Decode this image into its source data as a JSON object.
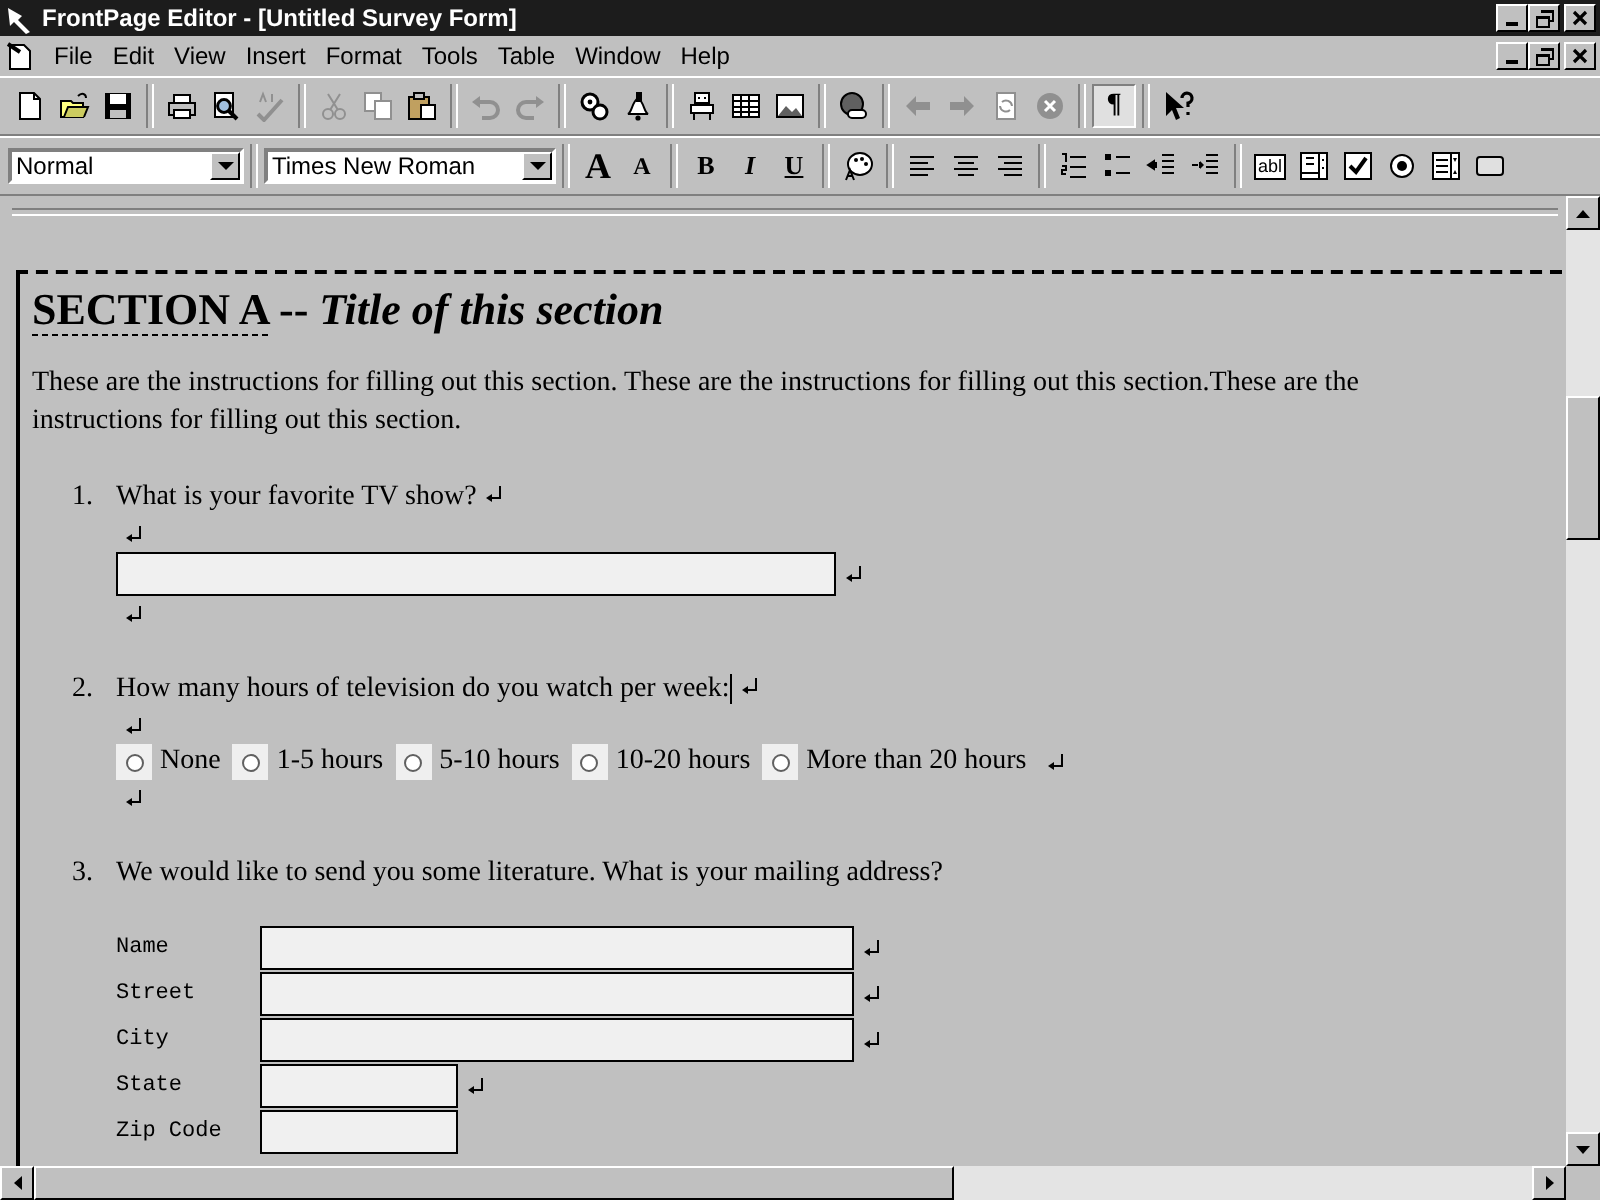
{
  "window": {
    "title": "FrontPage Editor - [Untitled Survey Form]"
  },
  "menu": [
    {
      "label": "File"
    },
    {
      "label": "Edit"
    },
    {
      "label": "View"
    },
    {
      "label": "Insert"
    },
    {
      "label": "Format"
    },
    {
      "label": "Tools"
    },
    {
      "label": "Table"
    },
    {
      "label": "Window"
    },
    {
      "label": "Help"
    }
  ],
  "toolbar": [
    {
      "kind": "new",
      "disabled": false,
      "on": false
    },
    {
      "kind": "open",
      "disabled": false,
      "on": false
    },
    {
      "kind": "save",
      "disabled": false,
      "on": false
    },
    {
      "kind": "separator"
    },
    {
      "kind": "print",
      "disabled": false,
      "on": false
    },
    {
      "kind": "preview",
      "disabled": false,
      "on": false
    },
    {
      "kind": "spelling",
      "disabled": true,
      "on": false
    },
    {
      "kind": "separator"
    },
    {
      "kind": "cut",
      "disabled": true,
      "on": false
    },
    {
      "kind": "copy",
      "disabled": true,
      "on": false
    },
    {
      "kind": "paste",
      "disabled": false,
      "on": false
    },
    {
      "kind": "separator"
    },
    {
      "kind": "undo",
      "disabled": true,
      "on": false
    },
    {
      "kind": "redo",
      "disabled": true,
      "on": false
    },
    {
      "kind": "separator"
    },
    {
      "kind": "gears",
      "disabled": false,
      "on": false
    },
    {
      "kind": "bell",
      "disabled": false,
      "on": false
    },
    {
      "kind": "separator"
    },
    {
      "kind": "robot",
      "disabled": false,
      "on": false
    },
    {
      "kind": "table",
      "disabled": false,
      "on": false
    },
    {
      "kind": "image",
      "disabled": false,
      "on": false
    },
    {
      "kind": "separator"
    },
    {
      "kind": "link",
      "disabled": false,
      "on": false
    },
    {
      "kind": "separator"
    },
    {
      "kind": "back",
      "disabled": true,
      "on": false
    },
    {
      "kind": "forward",
      "disabled": true,
      "on": false
    },
    {
      "kind": "refresh",
      "disabled": true,
      "on": false
    },
    {
      "kind": "stop",
      "disabled": true,
      "on": false
    },
    {
      "kind": "separator"
    },
    {
      "kind": "marks",
      "label": "¶",
      "disabled": false,
      "on": true
    },
    {
      "kind": "separator"
    },
    {
      "kind": "help",
      "disabled": false,
      "on": false
    }
  ],
  "format_bar": {
    "style": {
      "value": "Normal"
    },
    "font": {
      "value": "Times New Roman"
    },
    "buttons": [
      {
        "kind": "grow",
        "label": "A"
      },
      {
        "kind": "shrink",
        "label": "A"
      },
      {
        "kind": "separator"
      },
      {
        "kind": "bold",
        "label": "B"
      },
      {
        "kind": "italic",
        "label": "I"
      },
      {
        "kind": "underline",
        "label": "U"
      },
      {
        "kind": "separator"
      },
      {
        "kind": "color"
      },
      {
        "kind": "separator"
      },
      {
        "kind": "align-left"
      },
      {
        "kind": "align-center"
      },
      {
        "kind": "align-right"
      },
      {
        "kind": "separator"
      },
      {
        "kind": "numbered"
      },
      {
        "kind": "bulleted"
      },
      {
        "kind": "outdent"
      },
      {
        "kind": "indent"
      },
      {
        "kind": "separator"
      },
      {
        "kind": "textbox",
        "label": "abl"
      },
      {
        "kind": "scrollbox"
      },
      {
        "kind": "checkbox"
      },
      {
        "kind": "radio"
      },
      {
        "kind": "dropdown"
      },
      {
        "kind": "pushbutton"
      }
    ]
  },
  "document": {
    "bookmark": "SECTION A",
    "heading": " -- *Title of this section*",
    "instructions": "These are the instructions for filling out this section. These are the instructions for filling out this section.These are the instructions for filling out this section.",
    "questions": [
      {
        "number": "1.",
        "text": "What is your favorite TV show?",
        "kind": "text",
        "cursor": false
      },
      {
        "number": "2.",
        "text": "How many hours of television do you watch per week:",
        "kind": "radio",
        "cursor": true,
        "options": [
          {
            "label": "None",
            "checked": false
          },
          {
            "label": "1-5 hours",
            "checked": false
          },
          {
            "label": "5-10 hours",
            "checked": false
          },
          {
            "label": "10-20 hours",
            "checked": false
          },
          {
            "label": "More than 20 hours",
            "checked": false
          }
        ]
      },
      {
        "number": "3.",
        "text": "We would like to send you some literature. What is your mailing address?",
        "kind": "address",
        "cursor": false,
        "fields": [
          {
            "label": "Name"
          },
          {
            "label": "Street"
          },
          {
            "label": "City"
          },
          {
            "label": "State"
          },
          {
            "label": "Zip Code"
          }
        ]
      }
    ]
  }
}
